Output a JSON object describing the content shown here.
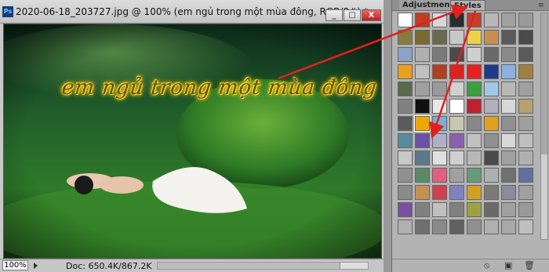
{
  "window": {
    "title": "2020-06-18_203727.jpg @ 100% (em ngủ trong một mùa đông, RGB/8#) *",
    "app_icon": "Ps",
    "min_label": "_",
    "max_label": "□",
    "close_label": "X"
  },
  "canvas": {
    "overlay_text": "em ngủ trong một mùa đông"
  },
  "status": {
    "zoom": "100%",
    "doc": "Doc: 650.4K/867.2K"
  },
  "panel": {
    "tabs": [
      {
        "label": "Adjustments"
      },
      {
        "label": "Styles"
      }
    ],
    "menu_icon": "≡",
    "bottom": {
      "clear": "⦸",
      "new": "▣",
      "delete": "🗑"
    },
    "swatches": [
      [
        "#ffffff",
        "#c23b22",
        "#d8d8d8",
        "#2c2c2c",
        "#c2402c",
        "#b8b8b8",
        "#a0a0a0",
        "#9a9a9a"
      ],
      [
        "#8a7a40",
        "#7a6a30",
        "#6a6a50",
        "#c8c8c8",
        "#ead24a",
        "#c89050",
        "#5a5a5a",
        "#4a4a4a"
      ],
      [
        "#8aa4c8",
        "#b0b0b0",
        "#7a7a7a",
        "#4a4a4a",
        "#d0d0d0",
        "#6a6a6a",
        "#8a8a8a",
        "#5a5a5a"
      ],
      [
        "#e8a020",
        "#c0c0c0",
        "#b04020",
        "#e02020",
        "#e82020",
        "#203a8a",
        "#8ab0e0",
        "#a08040"
      ],
      [
        "#5a6a4a",
        "#a0a0a0",
        "#9a9a9a",
        "#d0d0d0",
        "#3aa040",
        "#a0c8e8",
        "#b8b8b8",
        "#a0a0a0"
      ],
      [
        "#808080",
        "#101010",
        "#e8e8e8",
        "#ffffff",
        "#c02030",
        "#b0b0c0",
        "#d8d8d8",
        "#b8a070"
      ],
      [
        "#5a5a5a",
        "#f0a800",
        "#7ab0d8",
        "#c8c8b0",
        "#888888",
        "#e0a020",
        "#909090",
        "#a0a0a0"
      ],
      [
        "#5a8aa0",
        "#6a50a8",
        "#b0b0c8",
        "#8a60b0",
        "#c0c0c0",
        "#909090",
        "#d8d8d8",
        "#c0c0c0"
      ],
      [
        "#c8c8c8",
        "#5a7a8a",
        "#e0e0e0",
        "#d0d0d0",
        "#b8b8b8",
        "#4a4a4a",
        "#a0a0a0",
        "#b0b0b0"
      ],
      [
        "#909090",
        "#5a8a6a",
        "#e06080",
        "#a0a0a0",
        "#6a9a7a",
        "#b0b0b0",
        "#707070",
        "#6070a0"
      ],
      [
        "#8a8a8a",
        "#c89050",
        "#d04050",
        "#8080c0",
        "#d0a020",
        "#7a7a7a",
        "#8a8aa0",
        "#a0a0a0"
      ],
      [
        "#7a50a0",
        "#808080",
        "#c0c0c0",
        "#808080",
        "#a0a040",
        "#6a6a6a",
        "#a0a0a0",
        "#9a9a9a"
      ],
      [
        "#b0b0b0",
        "#707070",
        "#8a8a8a",
        "#606060",
        "#909090",
        "#b0b0b0",
        "#a8a8a8",
        "#c0c0c0"
      ]
    ]
  }
}
